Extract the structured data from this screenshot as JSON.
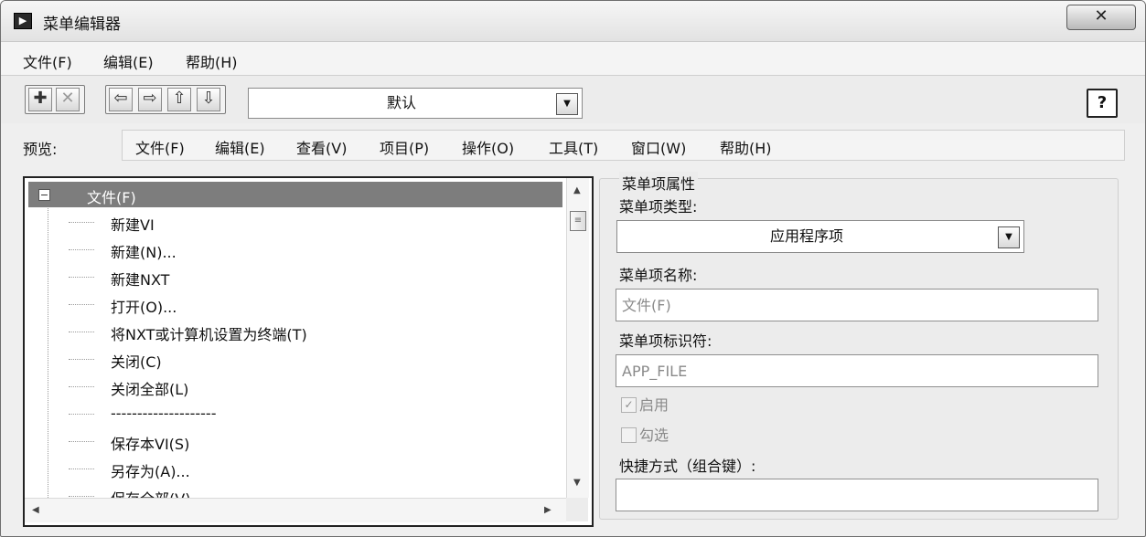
{
  "window": {
    "title": "菜单编辑器",
    "close_glyph": "✕"
  },
  "menubar": {
    "items": [
      "文件(F)",
      "编辑(E)",
      "帮助(H)"
    ]
  },
  "toolbar": {
    "add_glyph": "✚",
    "delete_glyph": "✕",
    "left_glyph": "⇦",
    "right_glyph": "⇨",
    "up_glyph": "⇧",
    "down_glyph": "⇩",
    "menu_type": "默认",
    "help_glyph": "?"
  },
  "preview": {
    "label": "预览:",
    "items": [
      "文件(F)",
      "编辑(E)",
      "查看(V)",
      "项目(P)",
      "操作(O)",
      "工具(T)",
      "窗口(W)",
      "帮助(H)"
    ]
  },
  "tree": {
    "root": "文件(F)",
    "expander": "−",
    "items": [
      "新建VI",
      "新建(N)...",
      "新建NXT",
      "打开(O)...",
      "将NXT或计算机设置为终端(T)",
      "关闭(C)",
      "关闭全部(L)",
      "--------------------",
      "保存本VI(S)",
      "另存为(A)...",
      "保存全部(V)"
    ]
  },
  "props": {
    "group_title": "菜单项属性",
    "type_label": "菜单项类型:",
    "type_value": "应用程序项",
    "name_label": "菜单项名称:",
    "name_value": "文件(F)",
    "tag_label": "菜单项标识符:",
    "tag_value": "APP_FILE",
    "enabled_label": "启用",
    "checked_label": "勾选",
    "shortcut_label": "快捷方式（组合键）:",
    "shortcut_value": ""
  },
  "icons": {
    "app": "labview-icon",
    "dropdown": "dropdown-arrow-icon"
  }
}
